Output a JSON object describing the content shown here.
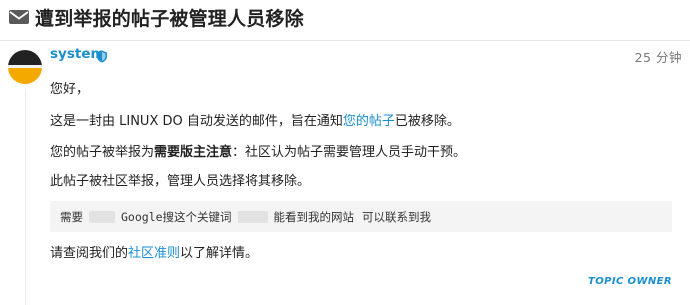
{
  "topic": {
    "title": "遭到举报的帖子被管理人员移除",
    "icon": "envelope-icon"
  },
  "post": {
    "author": "system",
    "author_badge_icon": "shield-icon",
    "time": "25 分钟",
    "greeting": "您好，",
    "line1_before": "这是一封由 LINUX DO 自动发送的邮件，旨在通知",
    "line1_link": "您的帖子",
    "line1_after": "已被移除。",
    "line2_before": "您的帖子被举报为",
    "line2_strong": "需要版主注意",
    "line2_after": "：社区认为帖子需要管理人员手动干预。",
    "line3": "此帖子被社区举报，管理人员选择将其移除。",
    "quote": {
      "part1": "需要",
      "part2": "Google搜这个关键词",
      "part3": "能看到我的网站",
      "part4": "可以联系到我"
    },
    "line4_before": "请查阅我们的",
    "line4_link": "社区准则",
    "line4_after": "以了解详情。",
    "owner_badge": "TOPIC OWNER"
  },
  "colors": {
    "link": "#1a8fcf",
    "quote_bg": "#f4f4f4",
    "avatar_top": "#222222",
    "avatar_bottom": "#f4a900"
  }
}
